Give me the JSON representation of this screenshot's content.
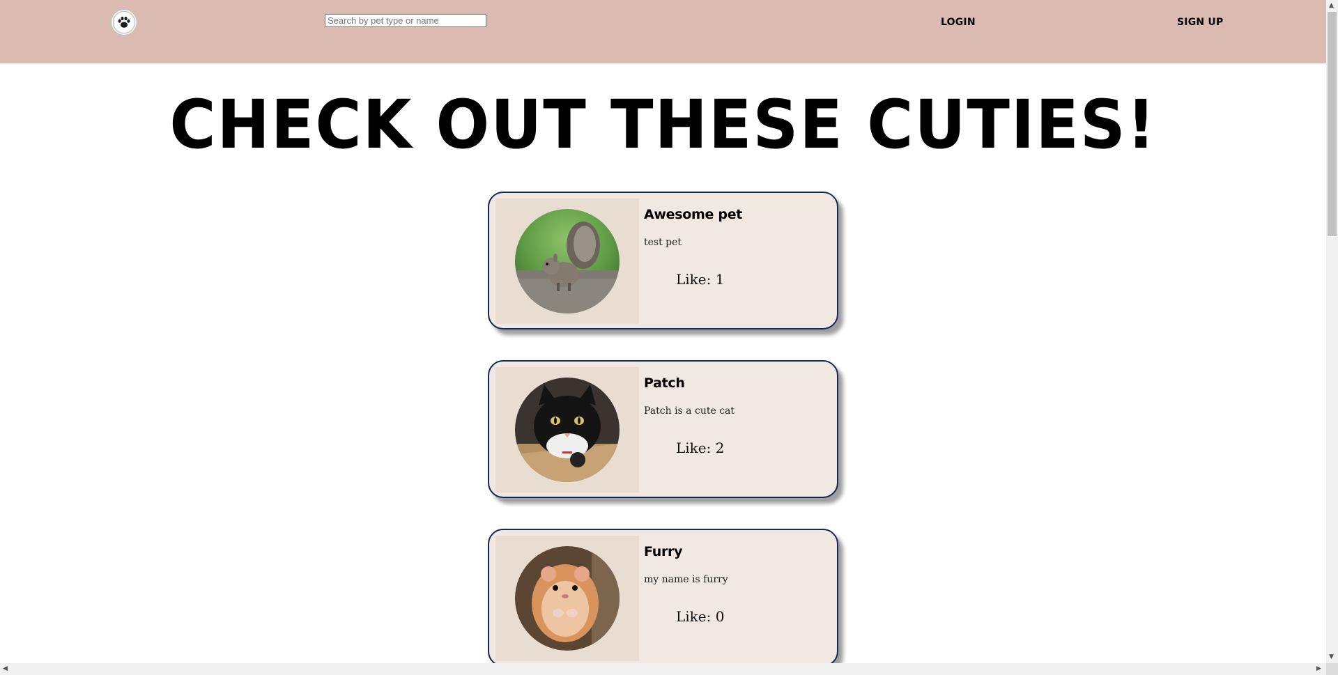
{
  "header": {
    "logo_icon": "paw-icon",
    "search_placeholder": "Search by pet type or name",
    "login_label": "LOGIN",
    "signup_label": "SIGN UP",
    "background_color": "#dbbab1"
  },
  "main": {
    "title": "CHECK OUT THESE CUTIES!"
  },
  "pets": [
    {
      "name": "Awesome pet",
      "description": "test pet",
      "likes_text": "Like: 1",
      "photo": "squirrel-photo"
    },
    {
      "name": "Patch",
      "description": "Patch is a cute cat",
      "likes_text": "Like: 2",
      "photo": "black-white-cat-photo"
    },
    {
      "name": "Furry",
      "description": "my name is furry",
      "likes_text": "Like: 0",
      "photo": "hamster-photo"
    }
  ],
  "colors": {
    "card_background": "#f0e8e1",
    "card_border": "#0d2a5c",
    "image_panel": "#e9ddd2"
  }
}
